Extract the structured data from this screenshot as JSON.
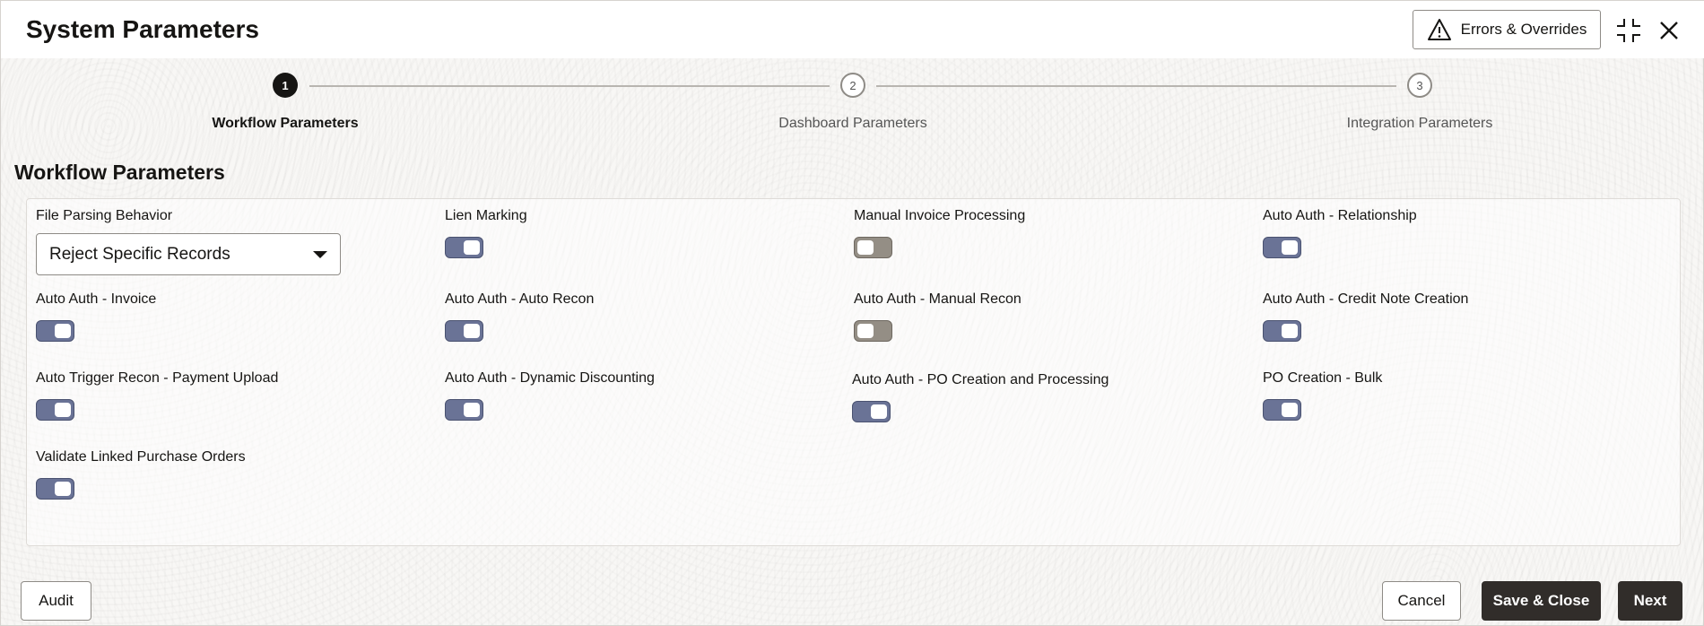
{
  "header": {
    "title": "System Parameters",
    "errors_label": "Errors & Overrides",
    "icons": [
      "warning-icon",
      "minimize-icon",
      "close-icon"
    ]
  },
  "train": {
    "steps": [
      {
        "number": "1",
        "label": "Workflow Parameters",
        "active": true
      },
      {
        "number": "2",
        "label": "Dashboard Parameters",
        "active": false
      },
      {
        "number": "3",
        "label": "Integration Parameters",
        "active": false
      }
    ]
  },
  "section": {
    "title": "Workflow Parameters"
  },
  "fields": {
    "file_parsing": {
      "label": "File Parsing Behavior",
      "value": "Reject Specific Records"
    },
    "toggles": [
      {
        "label": "Lien Marking",
        "on": true
      },
      {
        "label": "Manual Invoice Processing",
        "on": false
      },
      {
        "label": "Auto Auth - Relationship",
        "on": true
      },
      {
        "label": "Auto Auth - Invoice",
        "on": true
      },
      {
        "label": "Auto Auth - Auto Recon",
        "on": true
      },
      {
        "label": "Auto Auth - Manual Recon",
        "on": false
      },
      {
        "label": "Auto Auth - Credit Note Creation",
        "on": true
      },
      {
        "label": "Auto Trigger Recon - Payment Upload",
        "on": true
      },
      {
        "label": "Auto Auth - Dynamic Discounting",
        "on": true
      },
      {
        "label": "Auto Auth - PO Creation and Processing",
        "on": true
      },
      {
        "label": "PO Creation - Bulk",
        "on": true
      },
      {
        "label": "Validate Linked Purchase Orders",
        "on": true
      }
    ]
  },
  "footer": {
    "audit_label": "Audit",
    "cancel_label": "Cancel",
    "save_close_label": "Save & Close",
    "next_label": "Next"
  },
  "colors": {
    "toggle_on": "#6a7396",
    "toggle_off": "#948e85",
    "primary_button": "#312d2a",
    "active_step": "#161513"
  }
}
